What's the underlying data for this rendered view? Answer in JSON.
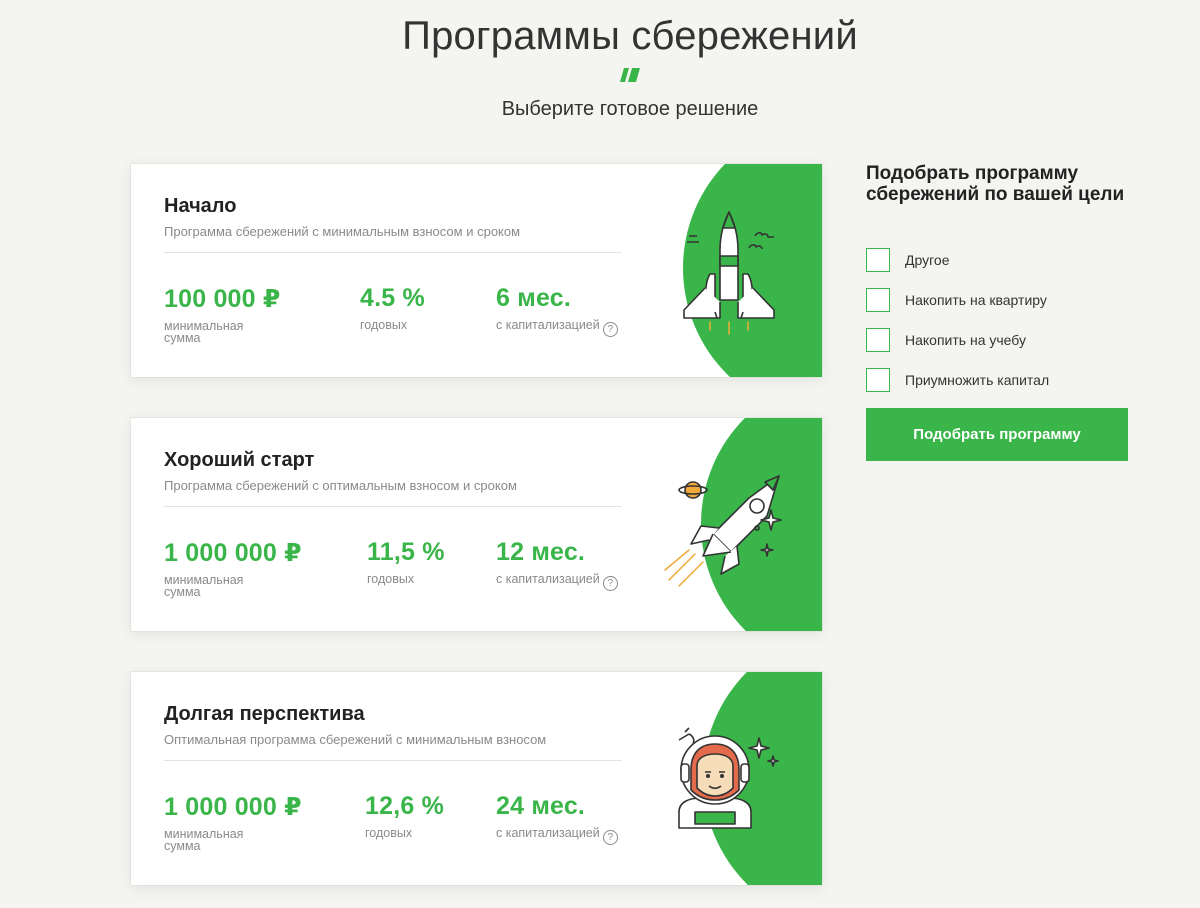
{
  "header": {
    "title": "Программы сбережений",
    "subtitle": "Выберите готовое решение",
    "logo_icon": "sber-stripes-icon"
  },
  "colors": {
    "accent": "#3ab54a",
    "background": "#f4f4f1",
    "card": "#ffffff",
    "muted_text": "#8a8a8a"
  },
  "programs": [
    {
      "title": "Начало",
      "description": "Программа сбережений с минимальным взносом и сроком",
      "amount": "100 000 ₽",
      "amount_label": "минимальная\nсумма",
      "rate": "4.5 %",
      "rate_label": "годовых",
      "term": "6 мес.",
      "term_label": "с капитализацией",
      "illustration": "shuttle-icon"
    },
    {
      "title": "Хороший старт",
      "description": "Программа сбережений с оптимальным взносом и сроком",
      "amount": "1 000 000 ₽",
      "amount_label": "минимальная\nсумма",
      "rate": "11,5 %",
      "rate_label": "годовых",
      "term": "12 мес.",
      "term_label": "с капитализацией",
      "illustration": "rocket-icon"
    },
    {
      "title": "Долгая перспектива",
      "description": "Оптимальная программа сбережений с минимальным взносом",
      "amount": "1 000 000 ₽",
      "amount_label": "минимальная\nсумма",
      "rate": "12,6 %",
      "rate_label": "годовых",
      "term": "24 мес.",
      "term_label": "с капитализацией",
      "illustration": "astronaut-icon"
    }
  ],
  "help_glyph": "?",
  "picker": {
    "title": "Подобрать программу сбережений по вашей цели",
    "options": [
      {
        "label": "Другое",
        "checked": false
      },
      {
        "label": "Накопить на квартиру",
        "checked": false
      },
      {
        "label": "Накопить на учебу",
        "checked": false
      },
      {
        "label": "Приумножить капитал",
        "checked": false
      }
    ],
    "submit_label": "Подобрать программу"
  }
}
